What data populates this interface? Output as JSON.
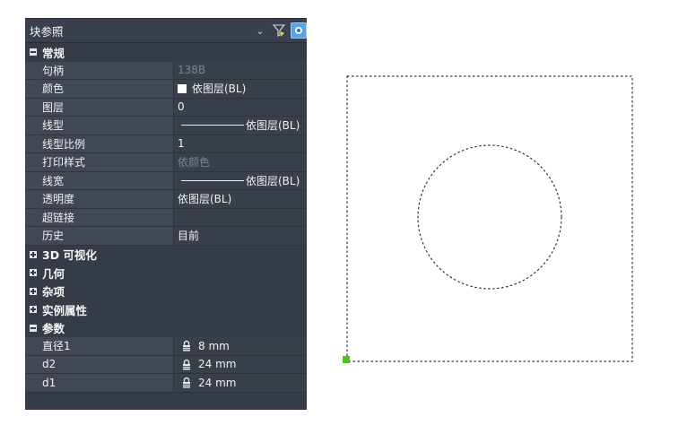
{
  "panel": {
    "selector": {
      "value": "块参照"
    },
    "sections": {
      "general": "常规",
      "visual3d": "3D 可视化",
      "geometry": "几何",
      "misc": "杂项",
      "instance": "实例属性",
      "params": "参数"
    },
    "general_rows": [
      {
        "label": "句柄",
        "value": "138B"
      },
      {
        "label": "颜色",
        "value": "依图层(BL)"
      },
      {
        "label": "图层",
        "value": "0"
      },
      {
        "label": "线型",
        "value": "依图层(BL)"
      },
      {
        "label": "线型比例",
        "value": "1"
      },
      {
        "label": "打印样式",
        "value": "依颜色"
      },
      {
        "label": "线宽",
        "value": "依图层(BL)"
      },
      {
        "label": "透明度",
        "value": "依图层(BL)"
      },
      {
        "label": "超链接",
        "value": ""
      },
      {
        "label": "历史",
        "value": "目前"
      }
    ],
    "param_rows": [
      {
        "label": "直径1",
        "value": "8 mm"
      },
      {
        "label": "d2",
        "value": "24 mm"
      },
      {
        "label": "d1",
        "value": "24 mm"
      }
    ],
    "icons": {
      "dropdown": "chevron-down-icon",
      "filter": "filter-select-icon",
      "quick": "quick-select-icon",
      "lock": "lock-icon"
    }
  },
  "colors": {
    "panel_bg": "#363c47",
    "key_bg": "#414753",
    "accent": "#5aa2e6",
    "grip": "#4cc51f"
  }
}
